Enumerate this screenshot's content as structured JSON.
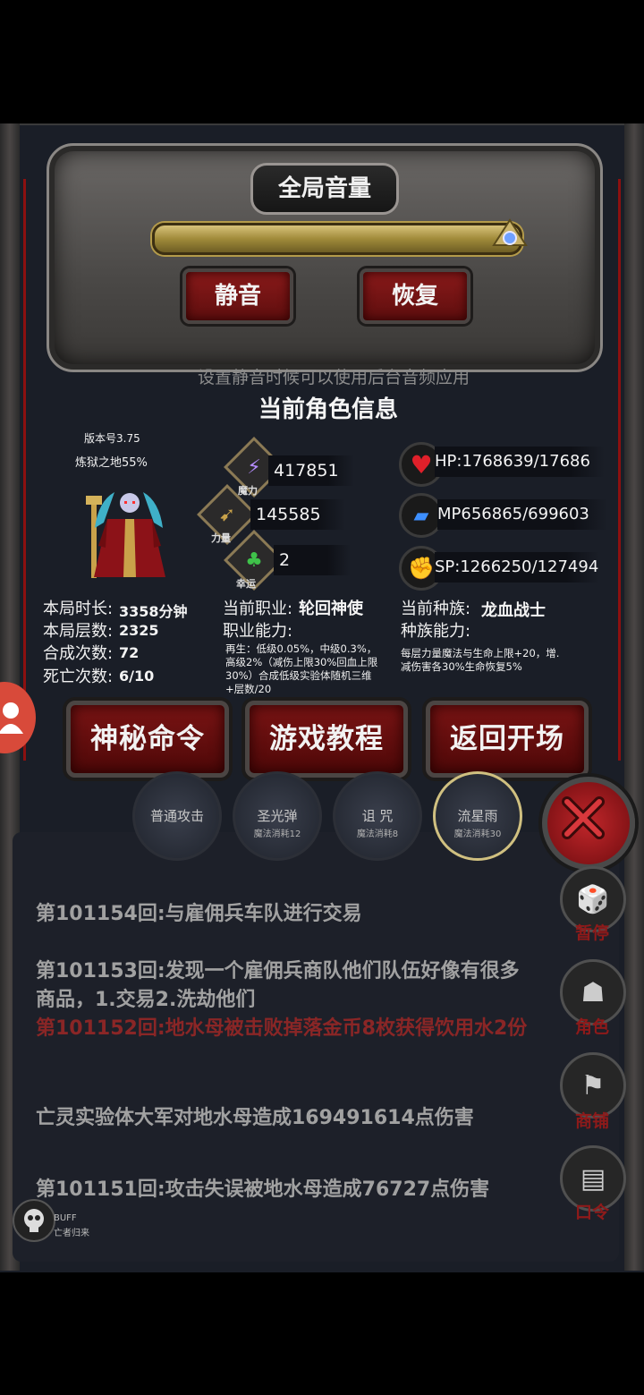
{
  "volume": {
    "title": "全局音量",
    "level_percent": 100,
    "mute_label": "静音",
    "restore_label": "恢复",
    "hint": "设置静音时候可以使用后台音频应用"
  },
  "character": {
    "title": "当前角色信息",
    "version": "版本号3.75",
    "hell_progress": "炼狱之地55%",
    "magic": {
      "label": "魔力",
      "value": "417851"
    },
    "strength": {
      "label": "力量",
      "value": "145585"
    },
    "luck": {
      "label": "幸运",
      "value": "2"
    },
    "hp": "HP:1768639/17686",
    "mp": "MP656865/699603",
    "sp": "SP:1266250/127494(",
    "stats": [
      {
        "label": "本局时长:",
        "value": "3358分钟"
      },
      {
        "label": "本局层数:",
        "value": "2325"
      },
      {
        "label": "合成次数:",
        "value": "72"
      },
      {
        "label": "死亡次数:",
        "value": "6/10"
      }
    ],
    "class_label": "当前职业:",
    "class_value": "轮回神使",
    "class_ability_label": "职业能力:",
    "class_ability_desc": "再生：低级0.05%，中级0.3%，高级2%（减伤上限30%回血上限30%）合成低级实验体随机三维+层数/20",
    "race_label": "当前种族:",
    "race_value": "龙血战士",
    "race_ability_label": "种族能力:",
    "race_ability_desc": "每层力量魔法与生命上限+20，增.减伤害各30%生命恢复5%"
  },
  "buttons": {
    "secret_cmd": "神秘命令",
    "tutorial": "游戏教程",
    "back_to_start": "返回开场"
  },
  "skills": [
    {
      "name": "普通攻击",
      "cost": ""
    },
    {
      "name": "圣光弹",
      "cost": "魔法消耗12"
    },
    {
      "name": "诅 咒",
      "cost": "魔法消耗8"
    },
    {
      "name": "流星雨",
      "cost": "魔法消耗30"
    }
  ],
  "log": [
    {
      "text": "第101154回:与雇佣兵车队进行交易",
      "color": "#a1a1a1"
    },
    {
      "text": "第101153回:发现一个雇佣兵商队他们队伍好像有很多商品，1.交易2.洗劫他们",
      "color": "#a1a1a1"
    },
    {
      "text": "第101152回:地水母被击败掉落金币8枚获得饮用水2份",
      "color": "#8a2626"
    },
    {
      "text": "亡灵实验体大军对地水母造成169491614点伤害",
      "color": "#a1a1a1"
    },
    {
      "text": "第101151回:攻击失误被地水母造成76727点伤害",
      "color": "#a1a1a1"
    }
  ],
  "side": {
    "pause": "暂停",
    "role": "角色",
    "shop": "商铺",
    "command": "口令"
  },
  "buff": {
    "label": "BUFF",
    "sub": "亡者归来"
  }
}
